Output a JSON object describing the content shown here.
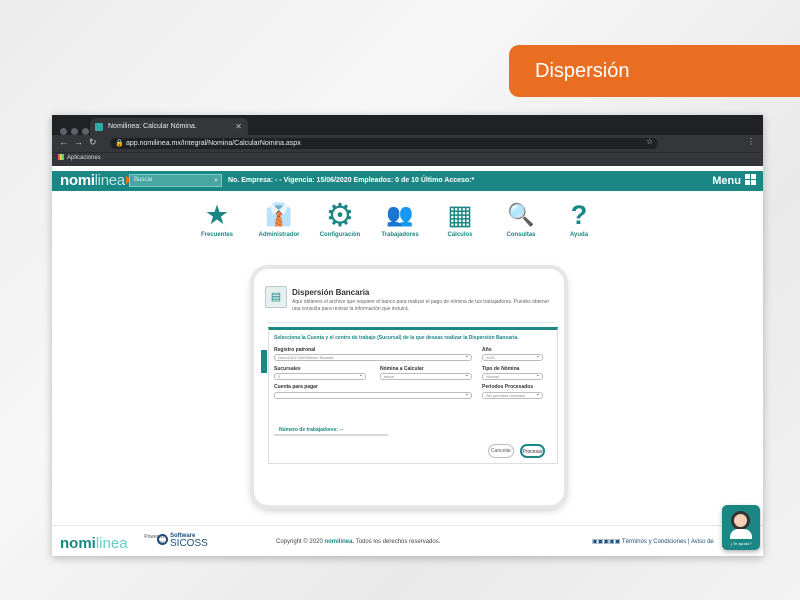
{
  "slide": {
    "tag_label": "Dispersión"
  },
  "browser": {
    "tab_title": "Nomilinea: Calcular Nómina.",
    "url": "app.nomilinea.mx/Integral/Nomina/CalcularNomina.aspx",
    "bookmark": "Aplicaciones"
  },
  "app": {
    "logo_part1": "nomi",
    "logo_part2": "linea",
    "search_placeholder": "Buscar",
    "info": "No. Empresa: - - Vigencia: 15/06/2020 Empleados: 0 de 10 Último Acceso:*",
    "menu_label": "Menu"
  },
  "nav": [
    {
      "label": "Frecuentes",
      "icon": "star-icon",
      "glyph": "★"
    },
    {
      "label": "Administrador",
      "icon": "administrator-icon",
      "glyph": "👔"
    },
    {
      "label": "Configuración",
      "icon": "gear-icon",
      "glyph": "⚙"
    },
    {
      "label": "Trabajadores",
      "icon": "workers-icon",
      "glyph": "👥"
    },
    {
      "label": "Cálculos",
      "icon": "calculator-icon",
      "glyph": "▦"
    },
    {
      "label": "Consultas",
      "icon": "search-icon",
      "glyph": "🔍"
    },
    {
      "label": "Ayuda",
      "icon": "help-icon",
      "glyph": "?"
    }
  ],
  "card": {
    "title": "Dispersión Bancaria",
    "description": "Aquí obtienes el archivo que requiere el banco para realizar el pago de nómina de tus trabajadores. Puedes obtener una consulta para revisar la información que incluirá.",
    "form_heading": "Selecciona la Cuenta y el centro de trabajo (Sucursal) de la que deseas realizar la Dispersión Bancaria.",
    "fields": {
      "registro_patronal": {
        "label": "Registro patronal",
        "value": "DemoO01Y0000Demo Nomina"
      },
      "anio": {
        "label": "Año",
        "value": "2020"
      },
      "sucursales": {
        "label": "Sucursales",
        "value": "0"
      },
      "nomina": {
        "label": "Nómina a Calcular",
        "value": "sema"
      },
      "tipo_nomina": {
        "label": "Tipo de Nómina",
        "value": "Normal"
      },
      "cuenta": {
        "label": "Cuenta para pagar",
        "value": ""
      },
      "periodos": {
        "label": "Periodos Procesados",
        "value": "Sin periodos cerrados"
      }
    },
    "num_trabajadores": "Número de trabajadores: --",
    "cancel_label": "Cancelar",
    "process_label": "Procesar"
  },
  "footer": {
    "logo_part1": "nomi",
    "logo_part2": "linea",
    "powered": "Powered by",
    "software": "Software",
    "sicoss": "SICOSS",
    "copyright_prefix": "Copyright © 2020",
    "copyright_brand": "nomilinea.",
    "copyright_suffix": "Todos los derechos reservados.",
    "links": "Términos y Condiciones | Aviso de"
  },
  "help_widget": {
    "label": "¿Te ayudo?"
  }
}
